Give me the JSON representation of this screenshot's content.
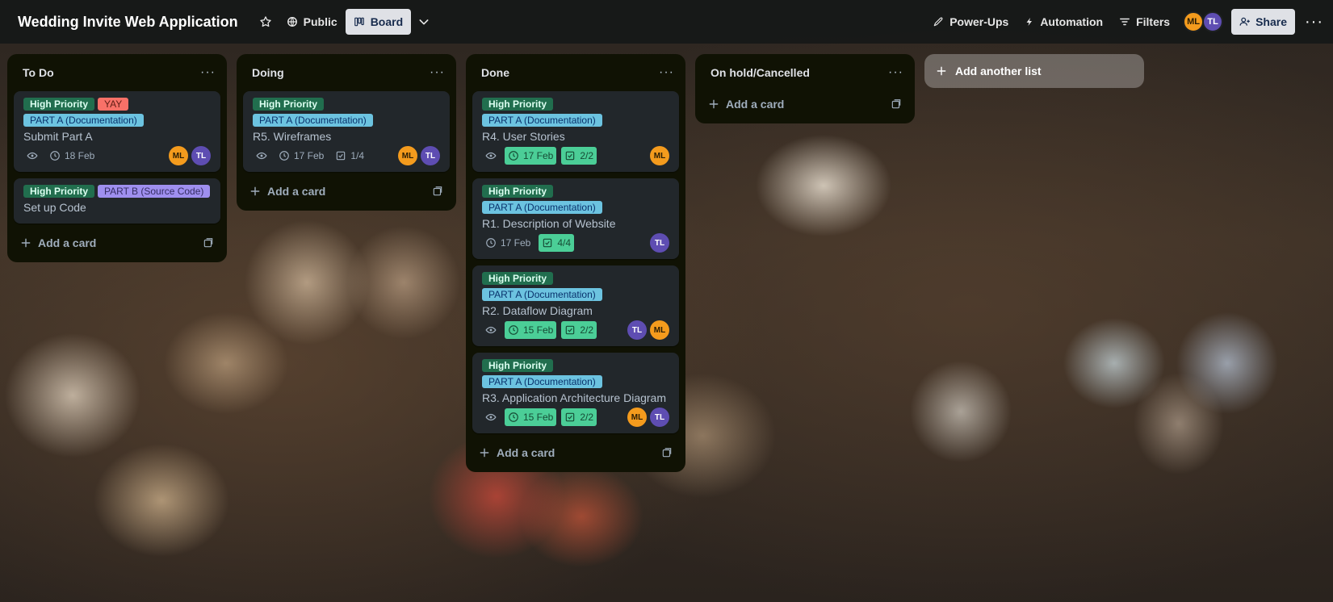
{
  "header": {
    "board_title": "Wedding Invite Web Application",
    "visibility_label": "Public",
    "view_label": "Board",
    "powerups_label": "Power-Ups",
    "automation_label": "Automation",
    "filters_label": "Filters",
    "members": [
      "ML",
      "TL"
    ],
    "share_label": "Share"
  },
  "labels": {
    "high": "High Priority",
    "yay": "YAY",
    "partA": "PART A (Documentation)",
    "partB": "PART B (Source Code)"
  },
  "lists": [
    {
      "title": "To Do",
      "add_card": "Add a card",
      "cards": [
        {
          "title": "Submit Part A",
          "date": "18 Feb",
          "members": [
            "ML",
            "TL"
          ]
        },
        {
          "title": "Set up Code"
        }
      ]
    },
    {
      "title": "Doing",
      "add_card": "Add a card",
      "cards": [
        {
          "title": "R5. Wireframes",
          "date": "17 Feb",
          "checklist": "1/4",
          "members": [
            "ML",
            "TL"
          ]
        }
      ]
    },
    {
      "title": "Done",
      "add_card": "Add a card",
      "cards": [
        {
          "title": "R4. User Stories",
          "date": "17 Feb",
          "checklist": "2/2",
          "members": [
            "ML"
          ]
        },
        {
          "title": "R1. Description of Website",
          "date": "17 Feb",
          "checklist": "4/4",
          "members": [
            "TL"
          ]
        },
        {
          "title": "R2. Dataflow Diagram",
          "date": "15 Feb",
          "checklist": "2/2",
          "members": [
            "TL",
            "ML"
          ]
        },
        {
          "title": "R3. Application Architecture Diagram",
          "date": "15 Feb",
          "checklist": "2/2",
          "members": [
            "ML",
            "TL"
          ]
        }
      ]
    },
    {
      "title": "On hold/Cancelled",
      "add_card": "Add a card",
      "cards": []
    }
  ],
  "add_list_label": "Add another list",
  "colors": {
    "high_priority": "#216e4e",
    "yay": "#f87168",
    "part_a": "#6cc3e0",
    "part_b": "#9f8fef",
    "complete_badge": "#4bce97",
    "avatar_ml": "#f49b1d",
    "avatar_tl": "#5e4db2"
  },
  "icons": [
    "star-icon",
    "globe-icon",
    "board-icon",
    "chevron-down-icon",
    "rocket-icon",
    "bolt-icon",
    "filter-icon",
    "add-member-icon",
    "dots-icon",
    "eye-icon",
    "clock-icon",
    "checklist-icon",
    "plus-icon",
    "template-icon"
  ]
}
